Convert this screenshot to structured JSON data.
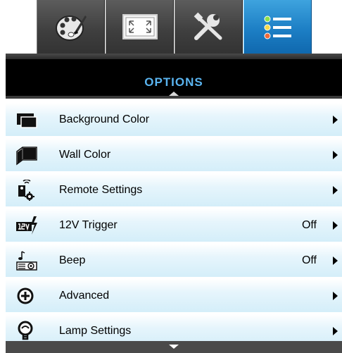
{
  "menu_title": "OPTIONS",
  "tabs": [
    {
      "name": "image-settings-tab",
      "icon": "palette-icon",
      "active": false
    },
    {
      "name": "display-tab",
      "icon": "display-aspect-icon",
      "active": false
    },
    {
      "name": "setup-tab",
      "icon": "tools-icon",
      "active": false
    },
    {
      "name": "options-tab",
      "icon": "options-list-icon",
      "active": true
    }
  ],
  "items": [
    {
      "label": "Background Color",
      "value": "",
      "icon": "background-color-icon"
    },
    {
      "label": "Wall Color",
      "value": "",
      "icon": "wall-color-icon"
    },
    {
      "label": "Remote Settings",
      "value": "",
      "icon": "remote-settings-icon"
    },
    {
      "label": "12V Trigger",
      "value": "Off",
      "icon": "trigger-12v-icon"
    },
    {
      "label": "Beep",
      "value": "Off",
      "icon": "beep-icon"
    },
    {
      "label": "Advanced",
      "value": "",
      "icon": "advanced-icon"
    },
    {
      "label": "Lamp Settings",
      "value": "",
      "icon": "lamp-settings-icon"
    }
  ],
  "colors": {
    "title": "#5ab4f0",
    "active_tab": "#1c7ec4",
    "item_bg": "#e6f5fc"
  }
}
